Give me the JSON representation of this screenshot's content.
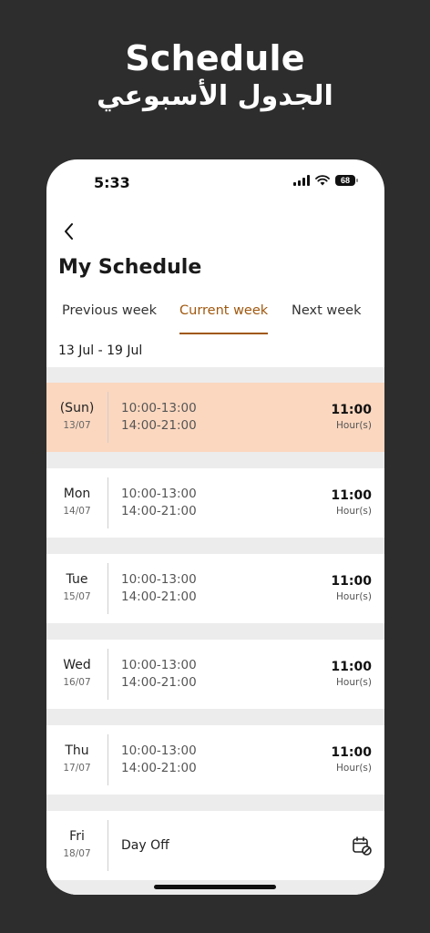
{
  "hero": {
    "title": "Schedule",
    "subtitle": "الجدول الأسبوعي"
  },
  "status_bar": {
    "time": "5:33",
    "battery": "68"
  },
  "page": {
    "title": "My Schedule",
    "date_range": "13 Jul - 19 Jul"
  },
  "tabs": [
    {
      "label": "Previous week",
      "active": false
    },
    {
      "label": "Current week",
      "active": true
    },
    {
      "label": "Next week",
      "active": false
    }
  ],
  "days": [
    {
      "name": "(Sun)",
      "date": "13/07",
      "shifts": [
        "10:00-13:00",
        "14:00-21:00"
      ],
      "hours": "11:00",
      "unit": "Hour(s)",
      "highlight": true
    },
    {
      "name": "Mon",
      "date": "14/07",
      "shifts": [
        "10:00-13:00",
        "14:00-21:00"
      ],
      "hours": "11:00",
      "unit": "Hour(s)"
    },
    {
      "name": "Tue",
      "date": "15/07",
      "shifts": [
        "10:00-13:00",
        "14:00-21:00"
      ],
      "hours": "11:00",
      "unit": "Hour(s)"
    },
    {
      "name": "Wed",
      "date": "16/07",
      "shifts": [
        "10:00-13:00",
        "14:00-21:00"
      ],
      "hours": "11:00",
      "unit": "Hour(s)"
    },
    {
      "name": "Thu",
      "date": "17/07",
      "shifts": [
        "10:00-13:00",
        "14:00-21:00"
      ],
      "hours": "11:00",
      "unit": "Hour(s)"
    },
    {
      "name": "Fri",
      "date": "18/07",
      "day_off": "Day Off"
    }
  ],
  "colors": {
    "accent": "#a0580f",
    "highlight_row": "#fbd7bf",
    "background": "#2d2d2d"
  }
}
